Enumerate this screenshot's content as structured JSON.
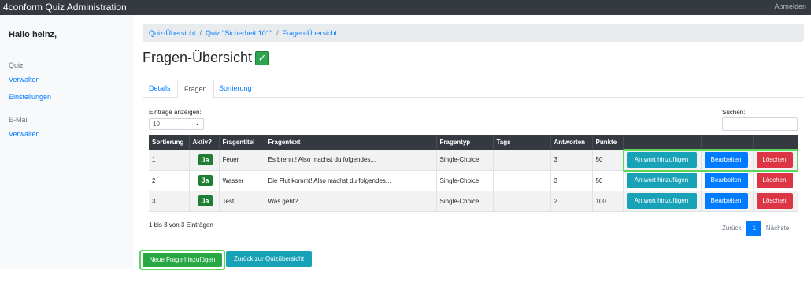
{
  "app": {
    "title": "4conform Quiz Administration",
    "logout": "Abmelden"
  },
  "sidebar": {
    "greeting": "Hallo heinz,",
    "sections": [
      {
        "heading": "Quiz",
        "links": [
          "Verwalten",
          "Einstellungen"
        ]
      },
      {
        "heading": "E-Mail",
        "links": [
          "Verwalten"
        ]
      }
    ]
  },
  "breadcrumb": [
    "Quiz-Übersicht",
    "Quiz \"Sicherheit 101\"",
    "Fragen-Übersicht"
  ],
  "page": {
    "title": "Fragen-Übersicht",
    "title_icon": "check-mark-icon"
  },
  "tabs": [
    {
      "label": "Details",
      "active": false
    },
    {
      "label": "Fragen",
      "active": true
    },
    {
      "label": "Sortierung",
      "active": false
    }
  ],
  "table_controls": {
    "length_label": "Einträge anzeigen:",
    "length_value": "10",
    "search_label": "Suchen:",
    "search_value": ""
  },
  "table": {
    "columns": [
      "Sortierung",
      "Aktiv?",
      "Fragentitel",
      "Fragentext",
      "Fragentyp",
      "Tags",
      "Antworten",
      "Punkte",
      "",
      "",
      ""
    ],
    "rows": [
      {
        "sortierung": "1",
        "aktiv": "Ja",
        "titel": "Feuer",
        "text": "Es brennt! Also machst du folgendes...",
        "typ": "Single-Choice",
        "tags": "",
        "antworten": "3",
        "punkte": "50"
      },
      {
        "sortierung": "2",
        "aktiv": "Ja",
        "titel": "Wasser",
        "text": "Die Flut kommt! Also machst du folgendes...",
        "typ": "Single-Choice",
        "tags": "",
        "antworten": "3",
        "punkte": "50"
      },
      {
        "sortierung": "3",
        "aktiv": "Ja",
        "titel": "Test",
        "text": "Was geht?",
        "typ": "Single-Choice",
        "tags": "",
        "antworten": "2",
        "punkte": "100"
      }
    ],
    "actions": {
      "add_answer": "Antwort hinzufügen",
      "edit": "Bearbeiten",
      "delete": "Löschen"
    }
  },
  "info": "1 bis 3 von 3 Einträgen",
  "pagination": {
    "prev": "Zurück",
    "current": "1",
    "next": "Nächste"
  },
  "bottom": {
    "new_question": "Neue Frage hinzufügen",
    "back": "Zurück zur Quizübersicht"
  },
  "colors": {
    "navbar": "#343a40",
    "primary": "#007bff",
    "info": "#17a2b8",
    "danger": "#dc3545",
    "success": "#28a745",
    "highlight": "#5cd65c"
  }
}
